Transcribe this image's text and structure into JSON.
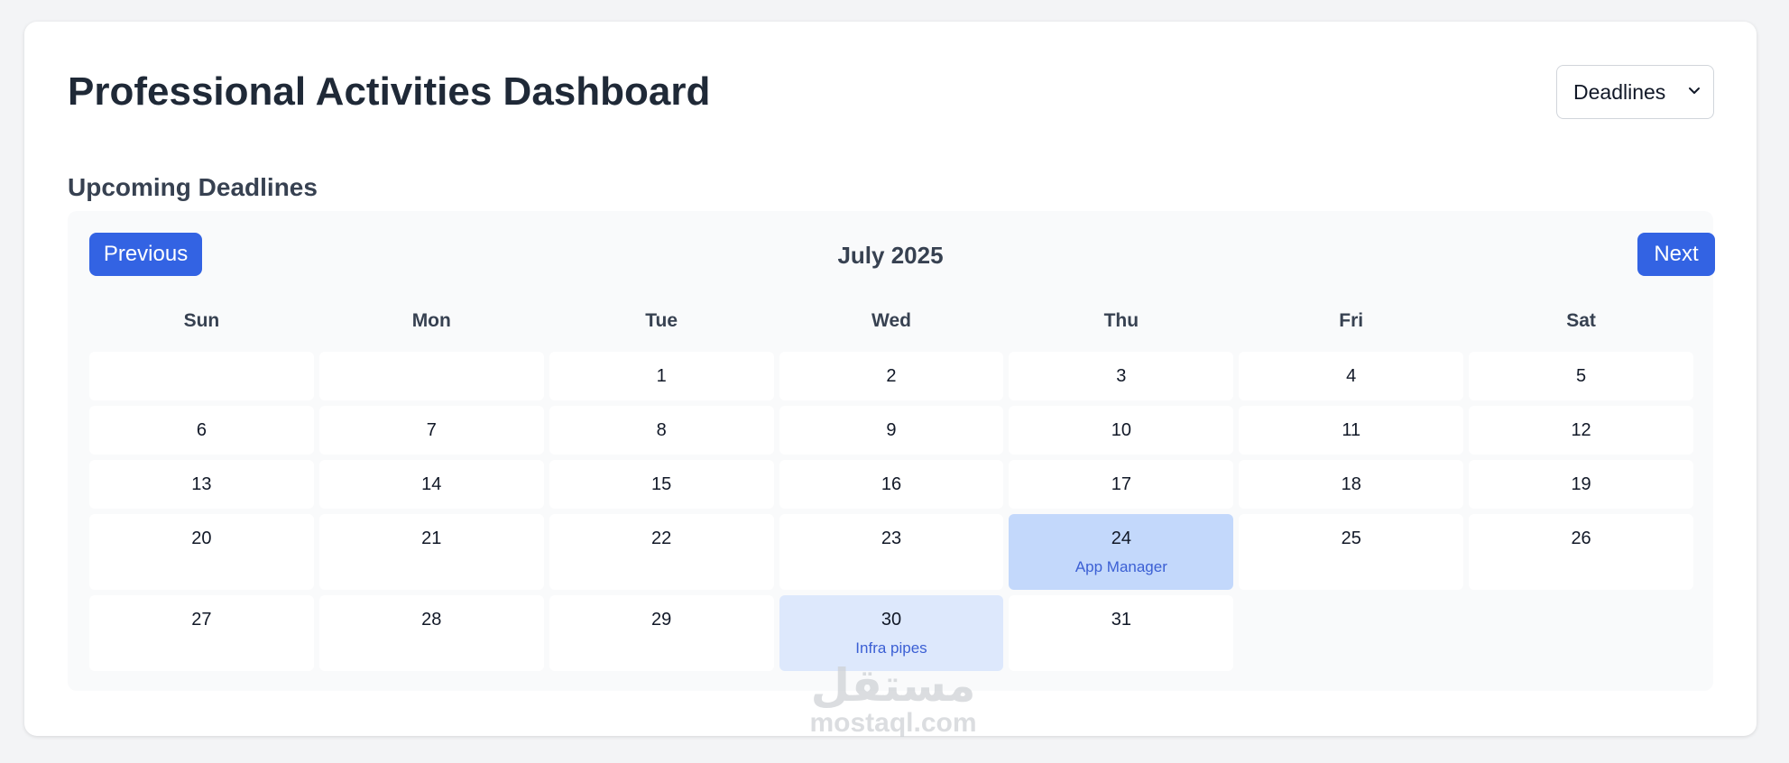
{
  "header": {
    "title": "Professional Activities Dashboard",
    "view_select": {
      "selected": "Deadlines",
      "icon": "chevron-down-icon"
    }
  },
  "section": {
    "title": "Upcoming Deadlines"
  },
  "calendar": {
    "prev_label": "Previous",
    "next_label": "Next",
    "month_label": "July 2025",
    "weekdays": [
      "Sun",
      "Mon",
      "Tue",
      "Wed",
      "Thu",
      "Fri",
      "Sat"
    ],
    "days": [
      {
        "num": "",
        "kind": "empty"
      },
      {
        "num": "",
        "kind": "empty"
      },
      {
        "num": "1"
      },
      {
        "num": "2"
      },
      {
        "num": "3"
      },
      {
        "num": "4"
      },
      {
        "num": "5"
      },
      {
        "num": "6"
      },
      {
        "num": "7"
      },
      {
        "num": "8"
      },
      {
        "num": "9"
      },
      {
        "num": "10"
      },
      {
        "num": "11"
      },
      {
        "num": "12"
      },
      {
        "num": "13"
      },
      {
        "num": "14"
      },
      {
        "num": "15"
      },
      {
        "num": "16"
      },
      {
        "num": "17"
      },
      {
        "num": "18"
      },
      {
        "num": "19"
      },
      {
        "num": "20"
      },
      {
        "num": "21"
      },
      {
        "num": "22"
      },
      {
        "num": "23"
      },
      {
        "num": "24",
        "event": "App Manager",
        "kind": "ev-strong"
      },
      {
        "num": "25"
      },
      {
        "num": "26"
      },
      {
        "num": "27"
      },
      {
        "num": "28"
      },
      {
        "num": "29"
      },
      {
        "num": "30",
        "event": "Infra pipes",
        "kind": "ev-light"
      },
      {
        "num": "31"
      },
      {
        "num": "",
        "kind": "blank"
      },
      {
        "num": "",
        "kind": "blank"
      }
    ]
  },
  "watermark": {
    "arabic": "مستقل",
    "latin": "mostaql.com"
  },
  "colors": {
    "primary_button": "#3363e3",
    "event_strong": "#c3d8fb",
    "event_light": "#dde8fc",
    "event_text": "#3b5fd4"
  }
}
